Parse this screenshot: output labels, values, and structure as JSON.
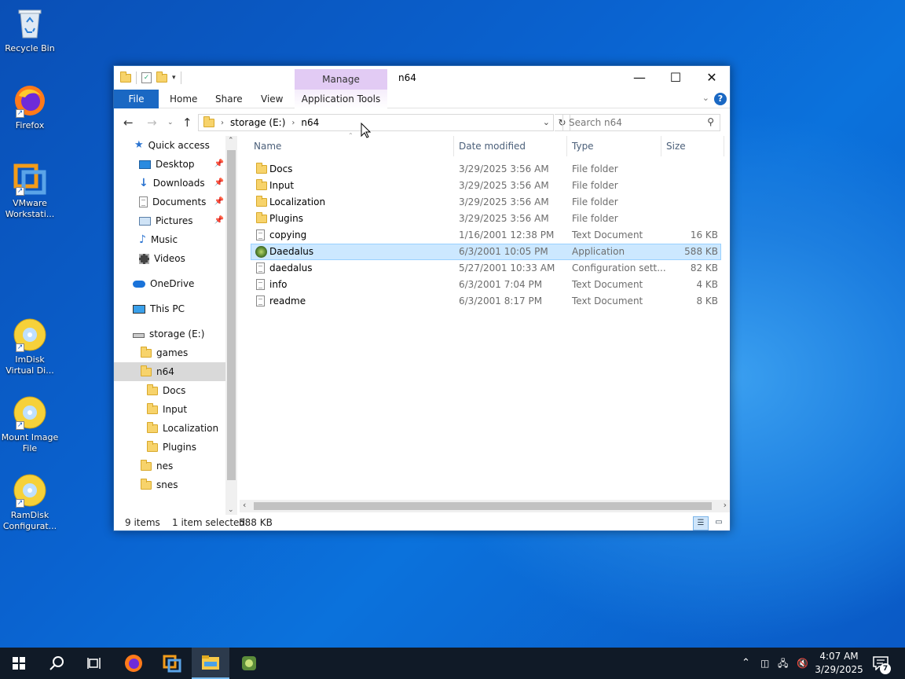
{
  "desktop": {
    "icons": [
      {
        "label": "Recycle Bin"
      },
      {
        "label": "Firefox"
      },
      {
        "label": "VMware Workstati..."
      },
      {
        "label": "ImDisk Virtual Di..."
      },
      {
        "label": "Mount Image File"
      },
      {
        "label": "RamDisk Configurat..."
      }
    ]
  },
  "window": {
    "title": "n64",
    "context_tab": "Manage",
    "ribbon_tabs": [
      "File",
      "Home",
      "Share",
      "View",
      "Application Tools"
    ],
    "address": {
      "segments": [
        "storage (E:)",
        "n64"
      ]
    },
    "search_placeholder": "Search n64",
    "nav": {
      "quick_access": "Quick access",
      "pinned": [
        "Desktop",
        "Downloads",
        "Documents",
        "Pictures"
      ],
      "others": [
        "Music",
        "Videos"
      ],
      "onedrive": "OneDrive",
      "this_pc": "This PC",
      "drive": "storage (E:)",
      "drive_children": [
        "games",
        "n64"
      ],
      "n64_children": [
        "Docs",
        "Input",
        "Localization",
        "Plugins"
      ],
      "after": [
        "nes",
        "snes"
      ]
    },
    "columns": [
      "Name",
      "Date modified",
      "Type",
      "Size"
    ],
    "files": [
      {
        "name": "Docs",
        "date": "3/29/2025 3:56 AM",
        "type": "File folder",
        "size": "",
        "icon": "folder-icon"
      },
      {
        "name": "Input",
        "date": "3/29/2025 3:56 AM",
        "type": "File folder",
        "size": "",
        "icon": "folder-icon"
      },
      {
        "name": "Localization",
        "date": "3/29/2025 3:56 AM",
        "type": "File folder",
        "size": "",
        "icon": "folder-icon"
      },
      {
        "name": "Plugins",
        "date": "3/29/2025 3:56 AM",
        "type": "File folder",
        "size": "",
        "icon": "folder-icon"
      },
      {
        "name": "copying",
        "date": "1/16/2001 12:38 PM",
        "type": "Text Document",
        "size": "16 KB",
        "icon": "text-file-icon"
      },
      {
        "name": "Daedalus",
        "date": "6/3/2001 10:05 PM",
        "type": "Application",
        "size": "588 KB",
        "icon": "application-icon",
        "selected": true
      },
      {
        "name": "daedalus",
        "date": "5/27/2001 10:33 AM",
        "type": "Configuration sett...",
        "size": "82 KB",
        "icon": "config-file-icon"
      },
      {
        "name": "info",
        "date": "6/3/2001 7:04 PM",
        "type": "Text Document",
        "size": "4 KB",
        "icon": "text-file-icon"
      },
      {
        "name": "readme",
        "date": "6/3/2001 8:17 PM",
        "type": "Text Document",
        "size": "8 KB",
        "icon": "text-file-icon"
      }
    ],
    "status": {
      "items": "9 items",
      "selected": "1 item selected",
      "size": "588 KB"
    }
  },
  "taskbar": {
    "time": "4:07 AM",
    "date": "3/29/2025",
    "notification_count": "7"
  },
  "colors": {
    "accent": "#1a68c3",
    "selection": "#cce8ff",
    "manage": "#e2cbf4"
  }
}
